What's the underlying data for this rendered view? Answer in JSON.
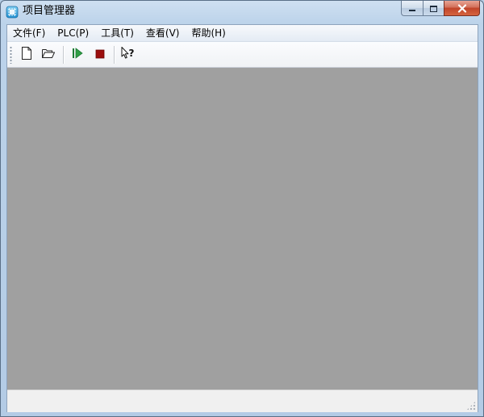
{
  "window": {
    "title": "项目管理器",
    "app_icon": "project-manager-icon"
  },
  "caption_buttons": {
    "minimize_icon": "minimize-icon",
    "maximize_icon": "maximize-icon",
    "close_icon": "close-icon"
  },
  "menu": {
    "items": [
      {
        "label": "文件(F)"
      },
      {
        "label": "PLC(P)"
      },
      {
        "label": "工具(T)"
      },
      {
        "label": "查看(V)"
      },
      {
        "label": "帮助(H)"
      }
    ]
  },
  "toolbar": {
    "buttons": [
      {
        "icon": "new-file-icon"
      },
      {
        "icon": "open-folder-icon"
      },
      {
        "icon": "run-icon"
      },
      {
        "icon": "stop-icon"
      },
      {
        "icon": "context-help-icon"
      }
    ]
  },
  "colors": {
    "workspace": "#a0a0a0",
    "run_green": "#2f9e44",
    "stop_red": "#9b0d0d",
    "close_red": "#c0442a"
  },
  "statusbar": {
    "text": ""
  }
}
